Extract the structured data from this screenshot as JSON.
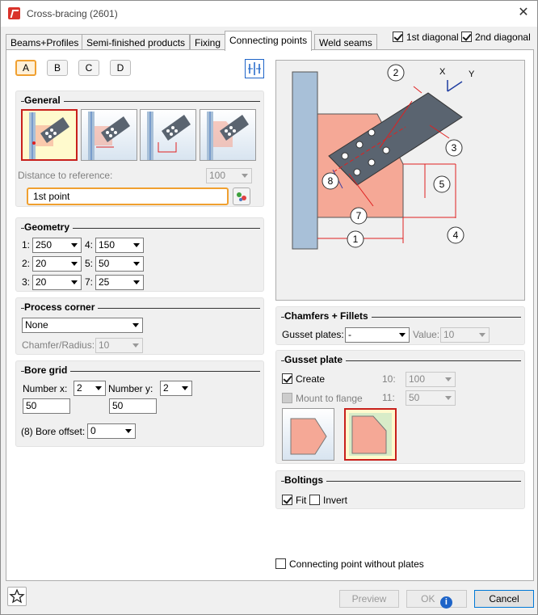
{
  "window": {
    "title": "Cross-bracing (2601)",
    "close": "✕"
  },
  "tabs": [
    {
      "label": "Beams+Profiles"
    },
    {
      "label": "Semi-finished products"
    },
    {
      "label": "Fixing"
    },
    {
      "label": "Connecting points"
    },
    {
      "label": "Weld seams"
    }
  ],
  "diagonals": {
    "first": "1st diagonal",
    "second": "2nd diagonal"
  },
  "variants": {
    "a": "A",
    "b": "B",
    "c": "C",
    "d": "D"
  },
  "general": {
    "title": "General",
    "distance_label": "Distance to reference:",
    "distance_value": "100",
    "point_value": "1st point"
  },
  "geometry": {
    "title": "Geometry",
    "fields": [
      {
        "label": "1:",
        "value": "250"
      },
      {
        "label": "4:",
        "value": "150"
      },
      {
        "label": "2:",
        "value": "20"
      },
      {
        "label": "5:",
        "value": "50"
      },
      {
        "label": "3:",
        "value": "20"
      },
      {
        "label": "7:",
        "value": "25"
      }
    ]
  },
  "process_corner": {
    "title": "Process corner",
    "value": "None",
    "chamfer_label": "Chamfer/Radius:",
    "chamfer_value": "10"
  },
  "bore_grid": {
    "title": "Bore grid",
    "number_x_label": "Number x:",
    "number_x_value": "2",
    "number_y_label": "Number y:",
    "number_y_value": "2",
    "spacing_x": "50",
    "spacing_y": "50",
    "offset_label": "(8) Bore offset:",
    "offset_value": "0"
  },
  "diagram": {
    "labels": [
      "1",
      "2",
      "3",
      "4",
      "5",
      "7",
      "8"
    ],
    "axis_x": "X",
    "axis_y": "Y"
  },
  "chamfers": {
    "title": "Chamfers + Fillets",
    "gusset_label": "Gusset plates:",
    "gusset_value": "-",
    "value_label": "Value:",
    "value_value": "10"
  },
  "gusset_plate": {
    "title": "Gusset plate",
    "create_label": "Create",
    "mount_label": "Mount to flange",
    "f10_label": "10:",
    "f10_value": "100",
    "f11_label": "11:",
    "f11_value": "50"
  },
  "boltings": {
    "title": "Boltings",
    "fit_label": "Fit",
    "invert_label": "Invert"
  },
  "no_plates_label": "Connecting point without plates",
  "buttons": {
    "preview": "Preview",
    "ok": "OK",
    "cancel": "Cancel"
  },
  "colors": {
    "accent": "#1e64c8",
    "plate": "#f5a896",
    "beam": "#5a6470",
    "column": "#a8c0d8",
    "dim": "#e02020"
  }
}
